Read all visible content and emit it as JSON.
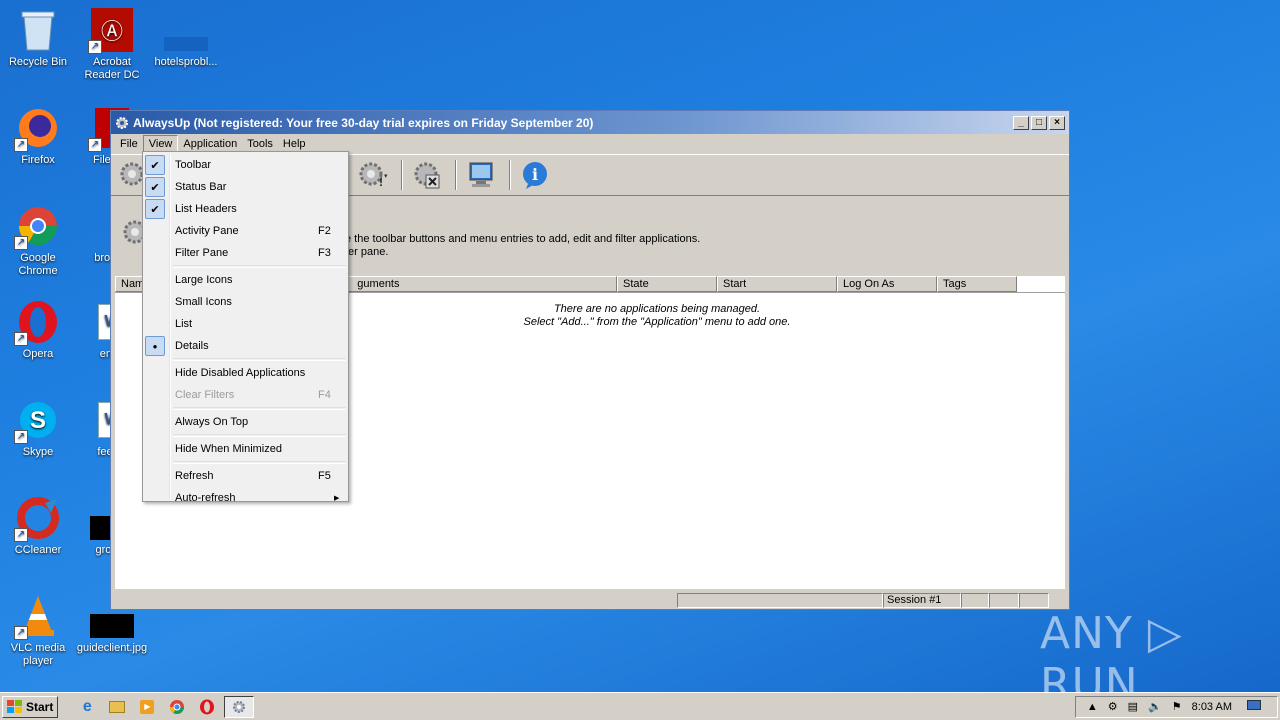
{
  "desktop": {
    "icons": [
      {
        "label": "Recycle Bin"
      },
      {
        "label": "Acrobat Reader DC"
      },
      {
        "label": "hotelsprobl..."
      },
      {
        "label": "Firefox"
      },
      {
        "label": "FileZilla"
      },
      {
        "label": "Google Chrome"
      },
      {
        "label": "browse"
      },
      {
        "label": "Opera"
      },
      {
        "label": "entry"
      },
      {
        "label": "Skype"
      },
      {
        "label": "feedw"
      },
      {
        "label": "CCleaner"
      },
      {
        "label": "growth"
      },
      {
        "label": "VLC media player"
      },
      {
        "label": "guideclient.jpg"
      }
    ]
  },
  "window": {
    "title": "AlwaysUp (Not registered: Your free 30-day trial expires on Friday September 20)",
    "menus": [
      "File",
      "View",
      "Application",
      "Tools",
      "Help"
    ],
    "info_line1": "e the toolbar buttons and menu entries to add, edit and filter applications.",
    "info_line2": "ter pane.",
    "columns": [
      "Nam",
      "guments",
      "State",
      "Start",
      "Log On As",
      "Tags"
    ],
    "empty_line1": "There are no applications being managed.",
    "empty_line2": "Select \"Add...\" from the \"Application\" menu to add one.",
    "status_session": "Session #1"
  },
  "view_menu": {
    "items": [
      {
        "label": "Toolbar",
        "check": "✔",
        "key": ""
      },
      {
        "label": "Status Bar",
        "check": "✔",
        "key": ""
      },
      {
        "label": "List Headers",
        "check": "✔",
        "key": ""
      },
      {
        "label": "Activity Pane",
        "check": "",
        "key": "F2"
      },
      {
        "label": "Filter Pane",
        "check": "",
        "key": "F3"
      },
      {
        "label": "Large Icons",
        "check": "",
        "key": ""
      },
      {
        "label": "Small Icons",
        "check": "",
        "key": ""
      },
      {
        "label": "List",
        "check": "",
        "key": ""
      },
      {
        "label": "Details",
        "check": "●",
        "key": ""
      },
      {
        "label": "Hide Disabled Applications",
        "check": "",
        "key": ""
      },
      {
        "label": "Clear Filters",
        "check": "",
        "key": "F4"
      },
      {
        "label": "Always On Top",
        "check": "",
        "key": ""
      },
      {
        "label": "Hide When Minimized",
        "check": "",
        "key": ""
      },
      {
        "label": "Refresh",
        "check": "",
        "key": "F5"
      },
      {
        "label": "Auto-refresh",
        "check": "",
        "key": "",
        "arrow": "▶"
      }
    ]
  },
  "taskbar": {
    "start_label": "Start",
    "clock": "8:03 AM"
  },
  "watermark": "ANY ▷ RUN"
}
